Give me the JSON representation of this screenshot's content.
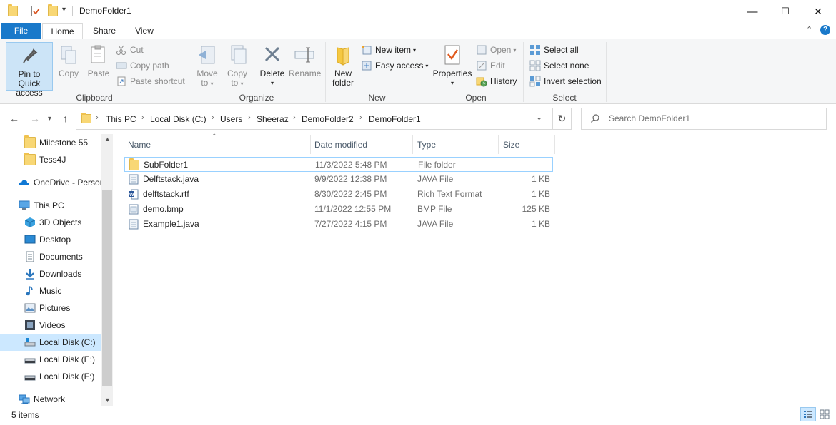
{
  "window": {
    "title": "DemoFolder1",
    "controls": {
      "minimize": "—",
      "maximize": "☐",
      "close": "✕"
    }
  },
  "ribbon_tabs": [
    "File",
    "Home",
    "Share",
    "View"
  ],
  "ribbon": {
    "clipboard": {
      "label": "Clipboard",
      "pin_line1": "Pin to Quick",
      "pin_line2": "access",
      "copy": "Copy",
      "paste": "Paste",
      "cut": "Cut",
      "copy_path": "Copy path",
      "paste_shortcut": "Paste shortcut"
    },
    "organize": {
      "label": "Organize",
      "move_line1": "Move",
      "move_line2": "to",
      "copy_line1": "Copy",
      "copy_line2": "to",
      "delete": "Delete",
      "rename": "Rename"
    },
    "new": {
      "label": "New",
      "folder_line1": "New",
      "folder_line2": "folder",
      "new_item": "New item",
      "easy_access": "Easy access"
    },
    "open": {
      "label": "Open",
      "properties": "Properties",
      "open": "Open",
      "edit": "Edit",
      "history": "History"
    },
    "select": {
      "label": "Select",
      "select_all": "Select all",
      "select_none": "Select none",
      "invert_selection": "Invert selection"
    }
  },
  "address": {
    "crumbs": [
      "This PC",
      "Local Disk (C:)",
      "Users",
      "Sheeraz",
      "DemoFolder2",
      "DemoFolder1"
    ]
  },
  "search": {
    "placeholder": "Search DemoFolder1"
  },
  "nav_pane": [
    {
      "label": "Milestone 55",
      "icon": "folder-icon"
    },
    {
      "label": "Tess4J",
      "icon": "folder-icon"
    },
    {
      "label": "OneDrive - Persor",
      "icon": "onedrive-icon"
    },
    {
      "label": "This PC",
      "icon": "this-pc-icon"
    },
    {
      "label": "3D Objects",
      "icon": "3d-objects-icon"
    },
    {
      "label": "Desktop",
      "icon": "desktop-icon"
    },
    {
      "label": "Documents",
      "icon": "documents-icon"
    },
    {
      "label": "Downloads",
      "icon": "downloads-icon"
    },
    {
      "label": "Music",
      "icon": "music-icon"
    },
    {
      "label": "Pictures",
      "icon": "pictures-icon"
    },
    {
      "label": "Videos",
      "icon": "videos-icon"
    },
    {
      "label": "Local Disk (C:)",
      "icon": "drive-icon",
      "selected": true
    },
    {
      "label": "Local Disk (E:)",
      "icon": "drive-icon"
    },
    {
      "label": "Local Disk (F:)",
      "icon": "drive-icon"
    },
    {
      "label": "Network",
      "icon": "network-icon"
    }
  ],
  "columns": [
    "Name",
    "Date modified",
    "Type",
    "Size"
  ],
  "files": [
    {
      "name": "SubFolder1",
      "date": "11/3/2022 5:48 PM",
      "type": "File folder",
      "size": "",
      "icon": "folder-icon",
      "selected": true
    },
    {
      "name": "Delftstack.java",
      "date": "9/9/2022 12:38 PM",
      "type": "JAVA File",
      "size": "1 KB",
      "icon": "java-file-icon"
    },
    {
      "name": "delftstack.rtf",
      "date": "8/30/2022 2:45 PM",
      "type": "Rich Text Format",
      "size": "1 KB",
      "icon": "word-file-icon"
    },
    {
      "name": "demo.bmp",
      "date": "11/1/2022 12:55 PM",
      "type": "BMP File",
      "size": "125 KB",
      "icon": "bmp-file-icon"
    },
    {
      "name": "Example1.java",
      "date": "7/27/2022 4:15 PM",
      "type": "JAVA File",
      "size": "1 KB",
      "icon": "java-file-icon"
    }
  ],
  "status": {
    "item_count": "5 items"
  },
  "colors": {
    "accent": "#1979ca",
    "selection": "#cce8ff",
    "folder": "#f8d775"
  }
}
